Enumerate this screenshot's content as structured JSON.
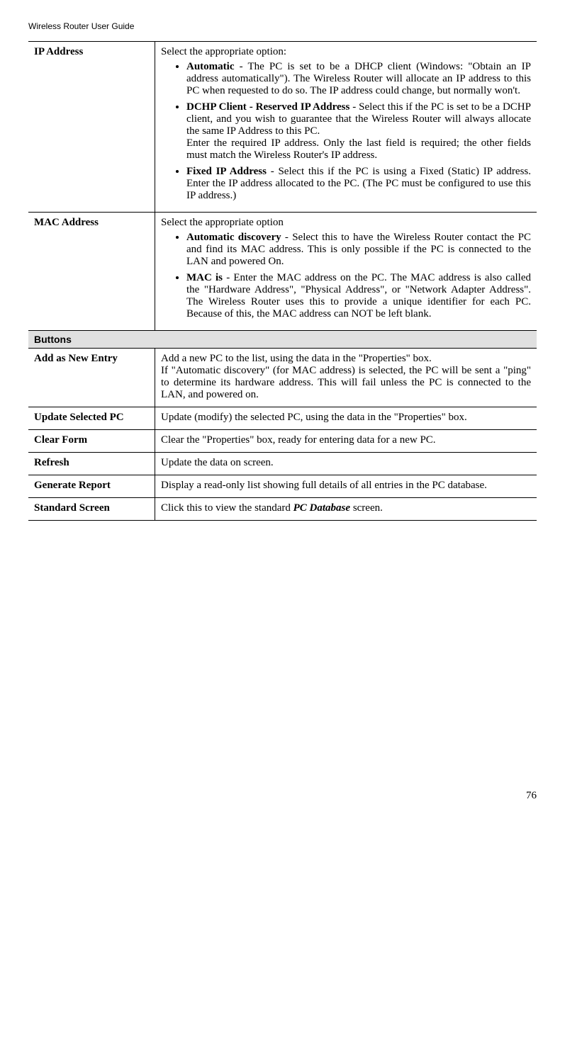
{
  "header": "Wireless Router User Guide",
  "row1": {
    "label": "IP Address",
    "intro": "Select the appropriate option:",
    "b1_bold": "Automatic",
    "b1_rest": " - The PC is set to be a DHCP client (Windows: \"Obtain an IP address automatically\"). The Wireless Router will allocate an IP address to this PC when requested to do so. The IP address could change, but normally won't.",
    "b2_bold": "DCHP Client - Reserved IP Address",
    "b2_rest": " - Select this if the PC is set to be a DCHP client, and you wish to guarantee that the Wireless Router will always allocate the same IP Address to this PC.",
    "b2_extra": "Enter the required IP address. Only the last field is required; the other fields must match the Wireless Router's IP address.",
    "b3_bold": "Fixed IP Address",
    "b3_rest": " - Select this if the PC is using a Fixed (Static) IP address. Enter the IP address allocated to the PC. (The PC must be configured to use this IP address.)"
  },
  "row2": {
    "label": "MAC Address",
    "intro": "Select the appropriate option",
    "b1_bold": "Automatic discovery",
    "b1_rest": " - Select this to have the Wireless Router contact the PC and find its MAC address. This is only possible if the PC is connected to the LAN and powered On.",
    "b2_bold": "MAC is",
    "b2_rest": " - Enter the MAC address on the PC. The MAC address is also called the \"Hardware Address\", \"Physical Address\", or \"Network Adapter Address\". The Wireless Router uses this to provide a unique identifier for each PC. Because of this, the MAC address can NOT be left blank."
  },
  "section_buttons": "Buttons",
  "row_add": {
    "label": "Add as New Entry",
    "line1": "Add a new PC to the list, using the data in the \"Properties\" box.",
    "line2": "If \"Automatic discovery\" (for MAC address) is selected, the PC will be sent a \"ping\" to determine its hardware address. This will fail unless the PC is connected to the LAN, and powered on."
  },
  "row_update": {
    "label": "Update Selected PC",
    "text": "Update (modify) the selected PC, using the data in the \"Properties\" box."
  },
  "row_clear": {
    "label": "Clear Form",
    "text": "Clear the \"Properties\" box, ready for entering data for a new PC."
  },
  "row_refresh": {
    "label": "Refresh",
    "text": "Update the data on screen."
  },
  "row_generate": {
    "label": "Generate Report",
    "text": "Display a read-only list showing full details of all entries in the PC database."
  },
  "row_standard": {
    "label": "Standard Screen",
    "pre": "Click this to view the standard ",
    "bold": "PC Database",
    "post": " screen."
  },
  "page_number": "76"
}
